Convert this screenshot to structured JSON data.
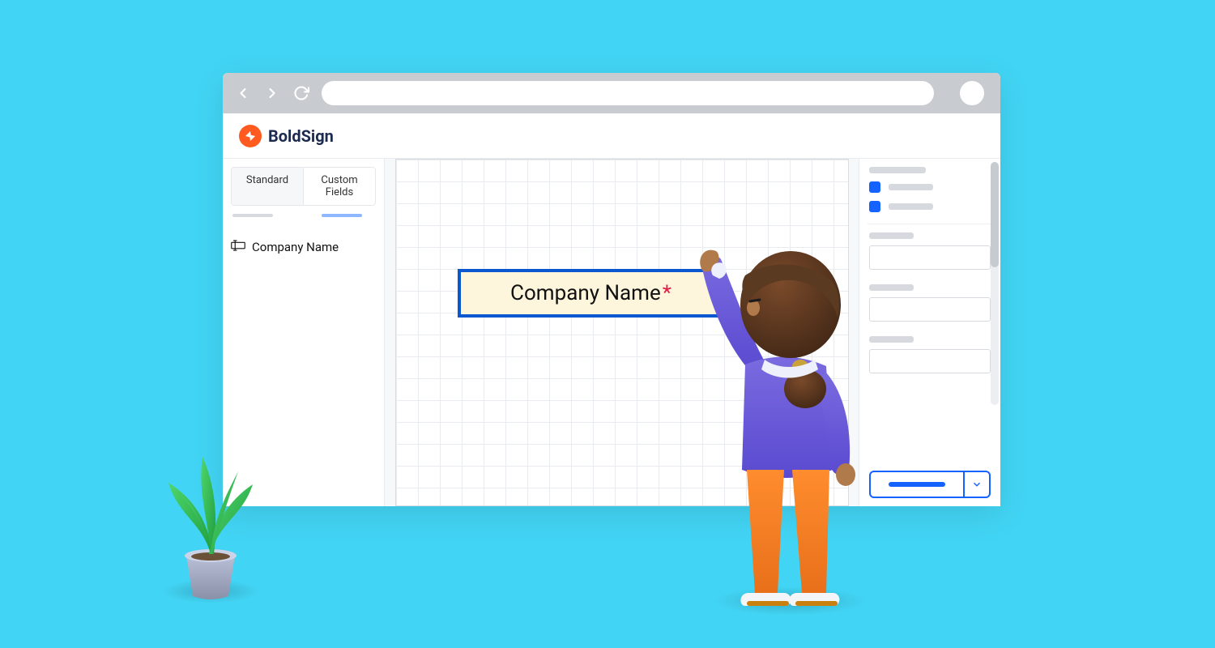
{
  "brand": {
    "name": "BoldSign"
  },
  "left": {
    "tabs": {
      "standard": "Standard",
      "custom": "Custom Fields"
    },
    "fields": [
      {
        "label": "Company Name"
      }
    ]
  },
  "canvas": {
    "placedField": {
      "label": "Company Name",
      "requiredMark": "*"
    }
  },
  "colors": {
    "accent": "#1463ff",
    "brand": "#ff5a1f",
    "bg": "#42d4f4",
    "fieldFill": "#fdf6dc",
    "fieldBorder": "#0b57d0"
  }
}
